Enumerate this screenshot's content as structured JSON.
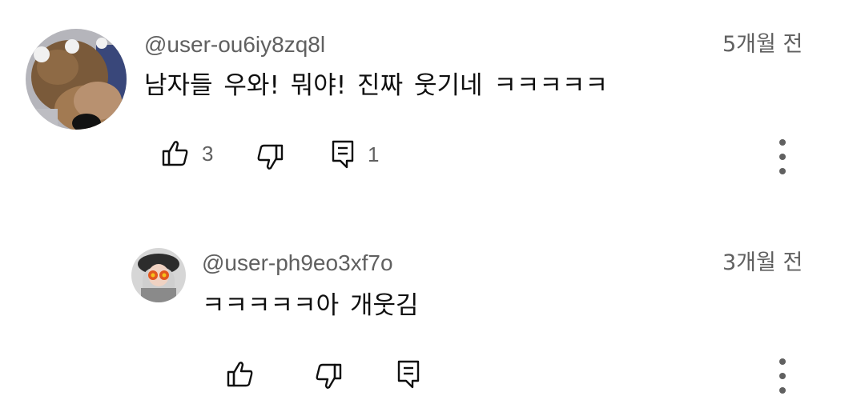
{
  "comments": [
    {
      "handle": "@user-ou6iy8zq8l",
      "time": "5개월 전",
      "text": "남자들 우와!  뭐야!  진짜 웃기네 ㅋㅋㅋㅋㅋ",
      "likes": "3",
      "replies": "1",
      "avatar": "plush-toy-avatar"
    },
    {
      "handle": "@user-ph9eo3xf7o",
      "time": "3개월 전",
      "text": "ㅋㅋㅋㅋㅋ아 개웃김",
      "avatar": "person-with-beret-avatar"
    }
  ],
  "icons": {
    "like": "thumbs-up-icon",
    "dislike": "thumbs-down-icon",
    "reply": "comment-icon",
    "more": "more-vertical-icon"
  },
  "colors": {
    "primary_text": "#0f0f0f",
    "secondary_text": "#606060",
    "background": "#ffffff"
  }
}
